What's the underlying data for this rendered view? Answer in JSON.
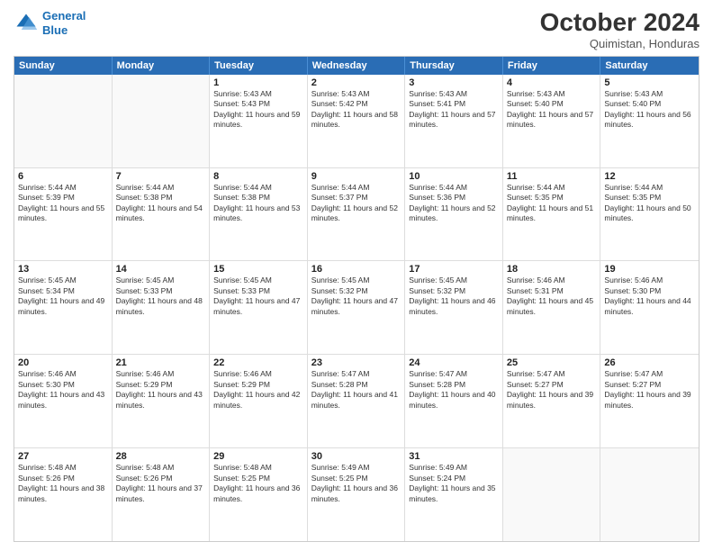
{
  "header": {
    "logo_line1": "General",
    "logo_line2": "Blue",
    "month": "October 2024",
    "location": "Quimistan, Honduras"
  },
  "weekdays": [
    "Sunday",
    "Monday",
    "Tuesday",
    "Wednesday",
    "Thursday",
    "Friday",
    "Saturday"
  ],
  "rows": [
    [
      {
        "day": "",
        "text": ""
      },
      {
        "day": "",
        "text": ""
      },
      {
        "day": "1",
        "text": "Sunrise: 5:43 AM\nSunset: 5:43 PM\nDaylight: 11 hours and 59 minutes."
      },
      {
        "day": "2",
        "text": "Sunrise: 5:43 AM\nSunset: 5:42 PM\nDaylight: 11 hours and 58 minutes."
      },
      {
        "day": "3",
        "text": "Sunrise: 5:43 AM\nSunset: 5:41 PM\nDaylight: 11 hours and 57 minutes."
      },
      {
        "day": "4",
        "text": "Sunrise: 5:43 AM\nSunset: 5:40 PM\nDaylight: 11 hours and 57 minutes."
      },
      {
        "day": "5",
        "text": "Sunrise: 5:43 AM\nSunset: 5:40 PM\nDaylight: 11 hours and 56 minutes."
      }
    ],
    [
      {
        "day": "6",
        "text": "Sunrise: 5:44 AM\nSunset: 5:39 PM\nDaylight: 11 hours and 55 minutes."
      },
      {
        "day": "7",
        "text": "Sunrise: 5:44 AM\nSunset: 5:38 PM\nDaylight: 11 hours and 54 minutes."
      },
      {
        "day": "8",
        "text": "Sunrise: 5:44 AM\nSunset: 5:38 PM\nDaylight: 11 hours and 53 minutes."
      },
      {
        "day": "9",
        "text": "Sunrise: 5:44 AM\nSunset: 5:37 PM\nDaylight: 11 hours and 52 minutes."
      },
      {
        "day": "10",
        "text": "Sunrise: 5:44 AM\nSunset: 5:36 PM\nDaylight: 11 hours and 52 minutes."
      },
      {
        "day": "11",
        "text": "Sunrise: 5:44 AM\nSunset: 5:35 PM\nDaylight: 11 hours and 51 minutes."
      },
      {
        "day": "12",
        "text": "Sunrise: 5:44 AM\nSunset: 5:35 PM\nDaylight: 11 hours and 50 minutes."
      }
    ],
    [
      {
        "day": "13",
        "text": "Sunrise: 5:45 AM\nSunset: 5:34 PM\nDaylight: 11 hours and 49 minutes."
      },
      {
        "day": "14",
        "text": "Sunrise: 5:45 AM\nSunset: 5:33 PM\nDaylight: 11 hours and 48 minutes."
      },
      {
        "day": "15",
        "text": "Sunrise: 5:45 AM\nSunset: 5:33 PM\nDaylight: 11 hours and 47 minutes."
      },
      {
        "day": "16",
        "text": "Sunrise: 5:45 AM\nSunset: 5:32 PM\nDaylight: 11 hours and 47 minutes."
      },
      {
        "day": "17",
        "text": "Sunrise: 5:45 AM\nSunset: 5:32 PM\nDaylight: 11 hours and 46 minutes."
      },
      {
        "day": "18",
        "text": "Sunrise: 5:46 AM\nSunset: 5:31 PM\nDaylight: 11 hours and 45 minutes."
      },
      {
        "day": "19",
        "text": "Sunrise: 5:46 AM\nSunset: 5:30 PM\nDaylight: 11 hours and 44 minutes."
      }
    ],
    [
      {
        "day": "20",
        "text": "Sunrise: 5:46 AM\nSunset: 5:30 PM\nDaylight: 11 hours and 43 minutes."
      },
      {
        "day": "21",
        "text": "Sunrise: 5:46 AM\nSunset: 5:29 PM\nDaylight: 11 hours and 43 minutes."
      },
      {
        "day": "22",
        "text": "Sunrise: 5:46 AM\nSunset: 5:29 PM\nDaylight: 11 hours and 42 minutes."
      },
      {
        "day": "23",
        "text": "Sunrise: 5:47 AM\nSunset: 5:28 PM\nDaylight: 11 hours and 41 minutes."
      },
      {
        "day": "24",
        "text": "Sunrise: 5:47 AM\nSunset: 5:28 PM\nDaylight: 11 hours and 40 minutes."
      },
      {
        "day": "25",
        "text": "Sunrise: 5:47 AM\nSunset: 5:27 PM\nDaylight: 11 hours and 39 minutes."
      },
      {
        "day": "26",
        "text": "Sunrise: 5:47 AM\nSunset: 5:27 PM\nDaylight: 11 hours and 39 minutes."
      }
    ],
    [
      {
        "day": "27",
        "text": "Sunrise: 5:48 AM\nSunset: 5:26 PM\nDaylight: 11 hours and 38 minutes."
      },
      {
        "day": "28",
        "text": "Sunrise: 5:48 AM\nSunset: 5:26 PM\nDaylight: 11 hours and 37 minutes."
      },
      {
        "day": "29",
        "text": "Sunrise: 5:48 AM\nSunset: 5:25 PM\nDaylight: 11 hours and 36 minutes."
      },
      {
        "day": "30",
        "text": "Sunrise: 5:49 AM\nSunset: 5:25 PM\nDaylight: 11 hours and 36 minutes."
      },
      {
        "day": "31",
        "text": "Sunrise: 5:49 AM\nSunset: 5:24 PM\nDaylight: 11 hours and 35 minutes."
      },
      {
        "day": "",
        "text": ""
      },
      {
        "day": "",
        "text": ""
      }
    ]
  ]
}
